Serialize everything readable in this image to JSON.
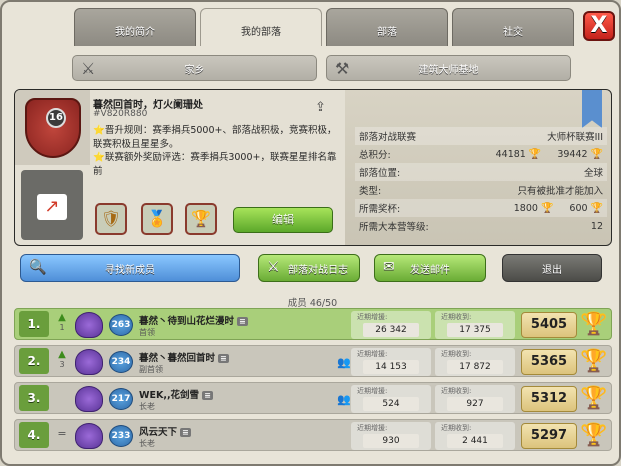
{
  "tabs": [
    "我的简介",
    "我的部落",
    "部落",
    "社交"
  ],
  "active_tab": 1,
  "close_label": "X",
  "subtabs": {
    "home": "家乡",
    "builder": "建筑大师基地"
  },
  "clan": {
    "level": "16",
    "name": "暮然回首时，灯火阑珊处",
    "tag": "#V820R880",
    "description": [
      "⭐晋升规则：赛季捐兵5000+、部落战积极，竞赛积极，联赛积极且星星多。",
      "⭐联赛额外奖励评选：赛季捐兵3000+，联赛星星排名靠前"
    ],
    "edit_label": "编辑",
    "info": [
      {
        "label": "部落对战联赛",
        "value": "大师杯联赛III"
      },
      {
        "label": "总积分:",
        "value": "44181",
        "value2": "39442"
      },
      {
        "label": "部落位置:",
        "value": "全球"
      },
      {
        "label": "类型:",
        "value": "只有被批准才能加入"
      },
      {
        "label": "所需奖杯:",
        "value": "1800",
        "value2": "600"
      },
      {
        "label": "所需大本营等级:",
        "value": "12"
      }
    ]
  },
  "actions": {
    "find": "寻找新成员",
    "war_log": "部落对战日志",
    "mail": "发送邮件",
    "leave": "退出"
  },
  "members_label": "成员 46/50",
  "donation_labels": {
    "given": "近期增援:",
    "received": "近期收到:"
  },
  "members": [
    {
      "rank": "1.",
      "trend": "1",
      "trend_dir": "up",
      "level": "263",
      "name": "暮然丶待到山花烂漫时",
      "role": "首领",
      "given": "26 342",
      "received": "17 375",
      "trophies": "5405"
    },
    {
      "rank": "2.",
      "trend": "3",
      "trend_dir": "up",
      "level": "234",
      "name": "暮然丶暮然回首时",
      "role": "副首领",
      "given": "14 153",
      "received": "17 872",
      "trophies": "5365"
    },
    {
      "rank": "3.",
      "trend": "",
      "trend_dir": "none",
      "level": "217",
      "name": "WEK,,花剑雪",
      "role": "长老",
      "given": "524",
      "received": "927",
      "trophies": "5312"
    },
    {
      "rank": "4.",
      "trend": "=",
      "trend_dir": "same",
      "level": "233",
      "name": "风云天下",
      "role": "长老",
      "given": "930",
      "received": "2 441",
      "trophies": "5297"
    }
  ]
}
